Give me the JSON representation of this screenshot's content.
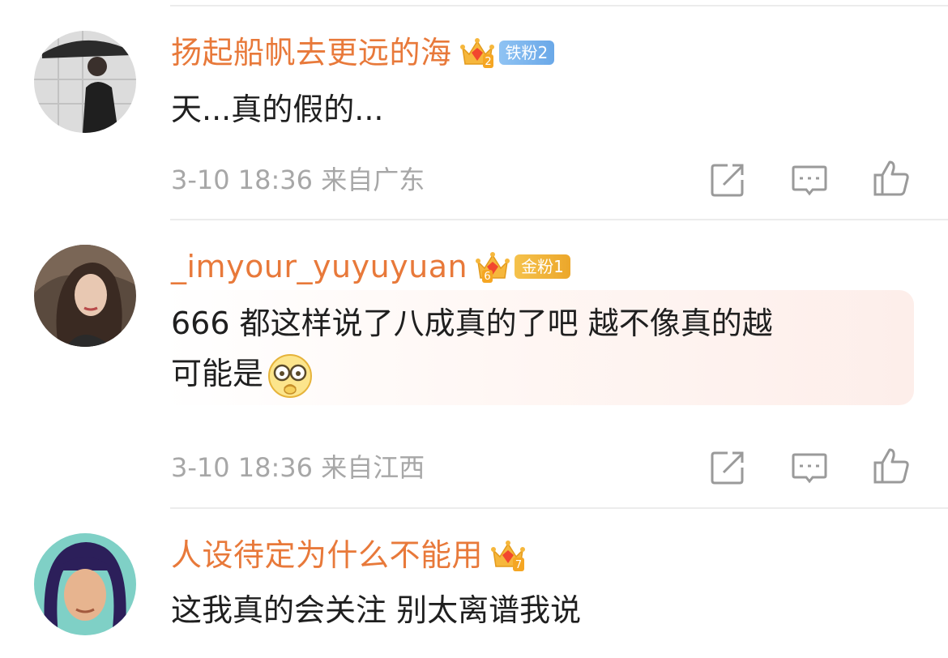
{
  "comments": [
    {
      "username": "扬起船帆去更远的海",
      "crown_level": "2",
      "fan_badge": "铁粉2",
      "text": "天...真的假的...",
      "time": "3-10 18:36",
      "location": "来自广东"
    },
    {
      "username": "_imyour_yuyuyuan",
      "crown_level": "6",
      "fan_badge": "金粉1",
      "text_line1": "666 都这样说了八成真的了吧 越不像真的越",
      "text_line2": "可能是",
      "time": "3-10 18:36",
      "location": "来自江西"
    },
    {
      "username": "人设待定为什么不能用",
      "crown_level": "7",
      "text": "这我真的会关注 别太离谱我说"
    }
  ],
  "icons": {
    "share": "share-icon",
    "comment": "comment-icon",
    "like": "thumbs-up-icon",
    "emoji": "glasses-emoji-icon"
  },
  "colors": {
    "username": "#e8793a",
    "meta": "#a7a7a7",
    "iron_badge": "#7ab3ee",
    "gold_badge": "#f0b43a"
  }
}
